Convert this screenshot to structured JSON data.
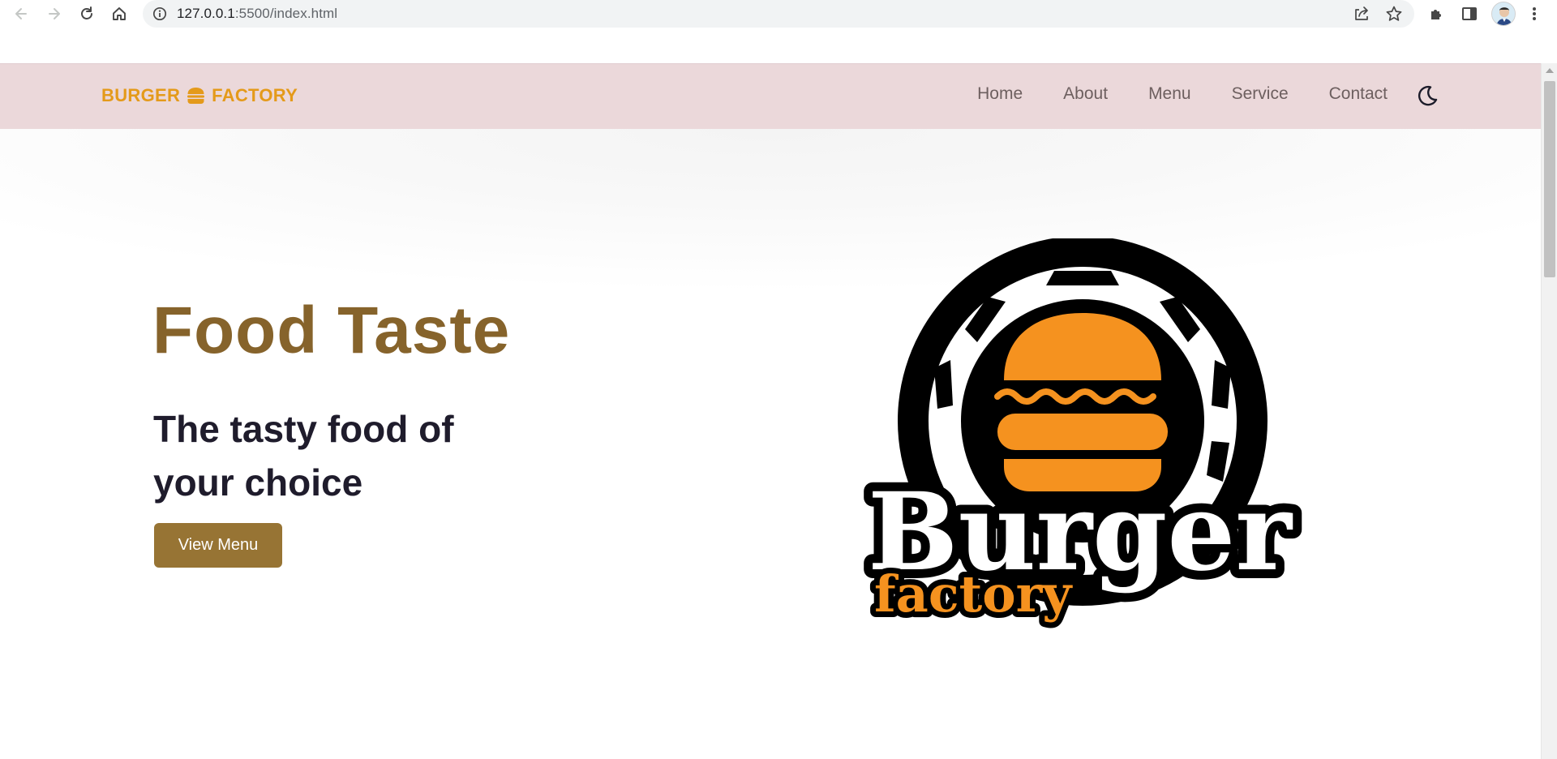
{
  "browser": {
    "url_host": "127.0.0.1",
    "url_rest": ":5500/index.html",
    "icons": [
      "back-arrow-icon",
      "forward-arrow-icon",
      "reload-icon",
      "home-icon",
      "info-icon",
      "share-icon",
      "star-icon",
      "extensions-icon",
      "side-panel-icon",
      "profile-avatar",
      "kebab-menu-icon"
    ]
  },
  "header": {
    "brand_left": "BURGER",
    "brand_right": "FACTORY",
    "nav": [
      "Home",
      "About",
      "Menu",
      "Service",
      "Contact"
    ],
    "theme_icon": "moon-icon"
  },
  "hero": {
    "title": "Food Taste",
    "subtitle": "The tasty food of your choice",
    "cta": "View Menu"
  },
  "logo": {
    "word1": "Burger",
    "word2": "factory"
  },
  "colors": {
    "header_bg": "#ebd8da",
    "brand": "#e49a1a",
    "title": "#86632b",
    "subtitle": "#1f1c2c",
    "button": "#977434",
    "logo_orange": "#f5921f"
  }
}
